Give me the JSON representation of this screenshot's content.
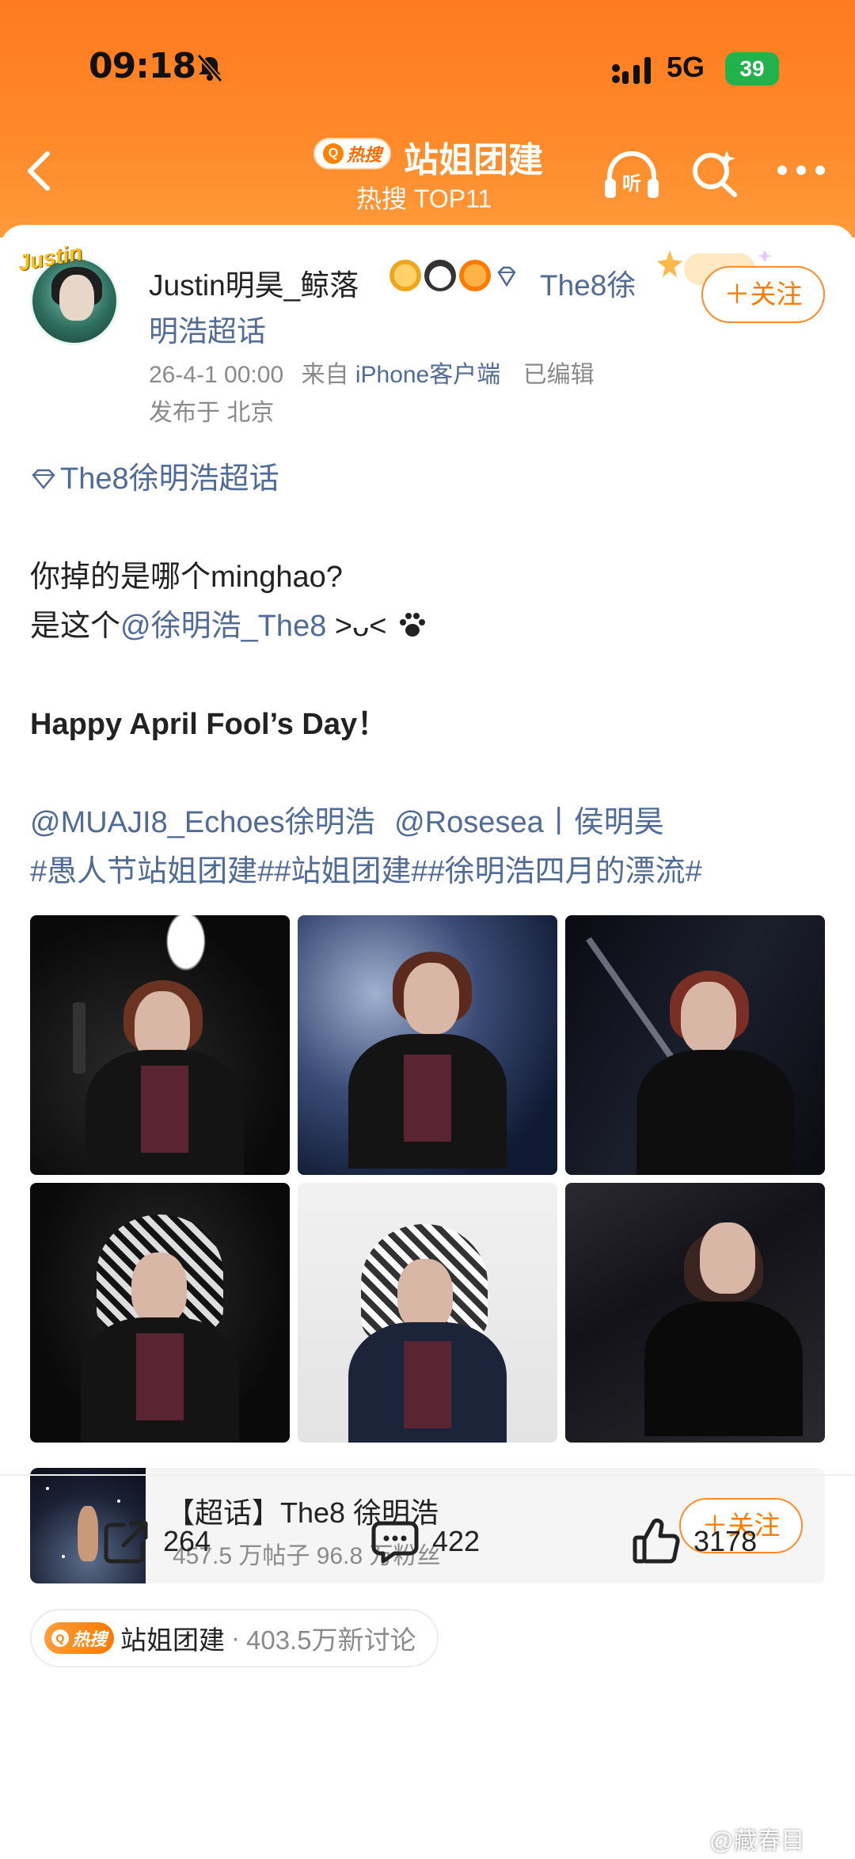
{
  "status_bar": {
    "time": "09:18",
    "network": "5G",
    "battery": "39"
  },
  "header": {
    "hot_tag": "热搜",
    "title": "站姐团建",
    "subtitle": "热搜 TOP11"
  },
  "post": {
    "username": "Justin明昊_鲸落",
    "avatar_badge": "Justin",
    "supertopic_link_line1": "The8徐",
    "supertopic_link_line2": "明浩超话",
    "follow_label": "＋关注",
    "timestamp": "26-4-1 00:00",
    "source_prefix": "来自",
    "device": "iPhone客户端",
    "edited": "已编辑",
    "location": "发布于 北京",
    "body": {
      "topic_tag": "The8徐明浩超话",
      "line1": "你掉的是哪个minghao?",
      "line2_prefix": "是这个",
      "line2_mention": "@徐明浩_The8",
      "line2_suffix": " >ᴗ<",
      "line3": "Happy April Fool’s Day！",
      "mention1": "@MUAJI8_Echoes徐明浩",
      "mention2": "@Rosesea",
      "mention2_suffix": "丨侯明昊",
      "hashtags": "#愚人节站姐团建##站姐团建##徐明浩四月的漂流#"
    }
  },
  "photos": [
    {
      "alt": "photo-1"
    },
    {
      "alt": "photo-2"
    },
    {
      "alt": "photo-3"
    },
    {
      "alt": "photo-4"
    },
    {
      "alt": "photo-5"
    },
    {
      "alt": "photo-6"
    }
  ],
  "topic_card": {
    "title": "【超话】The8 徐明浩",
    "stats": "457.5 万帖子 96.8 万粉丝",
    "follow_label": "＋关注"
  },
  "hot_pill": {
    "tag": "热搜",
    "topic": "站姐团建",
    "separator": "·",
    "count": "403.5万新讨论"
  },
  "actions": {
    "repost_count": "264",
    "comment_count": "422",
    "like_count": "3178"
  },
  "watermark": "@藏春目",
  "colors": {
    "accent": "#ff7a00",
    "link": "#506b97",
    "header_gradient_top": "#ff7a1f"
  }
}
